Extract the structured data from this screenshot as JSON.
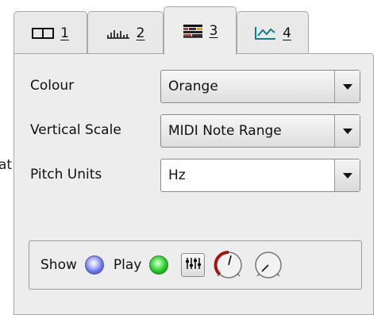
{
  "clipped_text": "at",
  "tabs": [
    {
      "number": "1",
      "icon": "waveform-layer-icon"
    },
    {
      "number": "2",
      "icon": "spectrum-bars-icon"
    },
    {
      "number": "3",
      "icon": "spectrogram-grid-icon",
      "active": true
    },
    {
      "number": "4",
      "icon": "line-graph-icon"
    }
  ],
  "colour": {
    "label": "Colour",
    "value": "Orange"
  },
  "vertical_scale": {
    "label": "Vertical Scale",
    "value": "MIDI Note Range"
  },
  "pitch_units": {
    "label": "Pitch Units",
    "value": "Hz"
  },
  "controls": {
    "show_label": "Show",
    "play_label": "Play",
    "show_led_color": "#6a70e8",
    "play_led_color": "#1fc21f",
    "gain_knob_color": "#a01818"
  }
}
